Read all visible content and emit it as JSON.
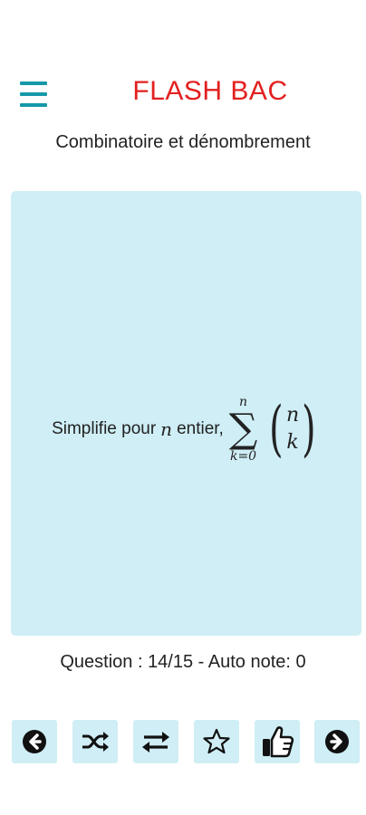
{
  "header": {
    "title": "FLASH BAC",
    "subtitle": "Combinatoire et dénombrement"
  },
  "card": {
    "prefix": "Simplifie pour",
    "variable": "n",
    "suffix": "entier,",
    "sum_upper": "n",
    "sum_sign": "∑",
    "sum_lower": "k=0",
    "binom_top": "n",
    "binom_bottom": "k"
  },
  "status": {
    "text": "Question : 14/15 - Auto note: 0"
  },
  "toolbar": {
    "icons": [
      "arrow-left-icon",
      "shuffle-icon",
      "swap-icon",
      "star-icon",
      "thumbs-up-icon",
      "arrow-right-icon"
    ]
  },
  "colors": {
    "accent": "#1598a9",
    "title": "#e2201f",
    "card_bg": "#cfeef5"
  }
}
